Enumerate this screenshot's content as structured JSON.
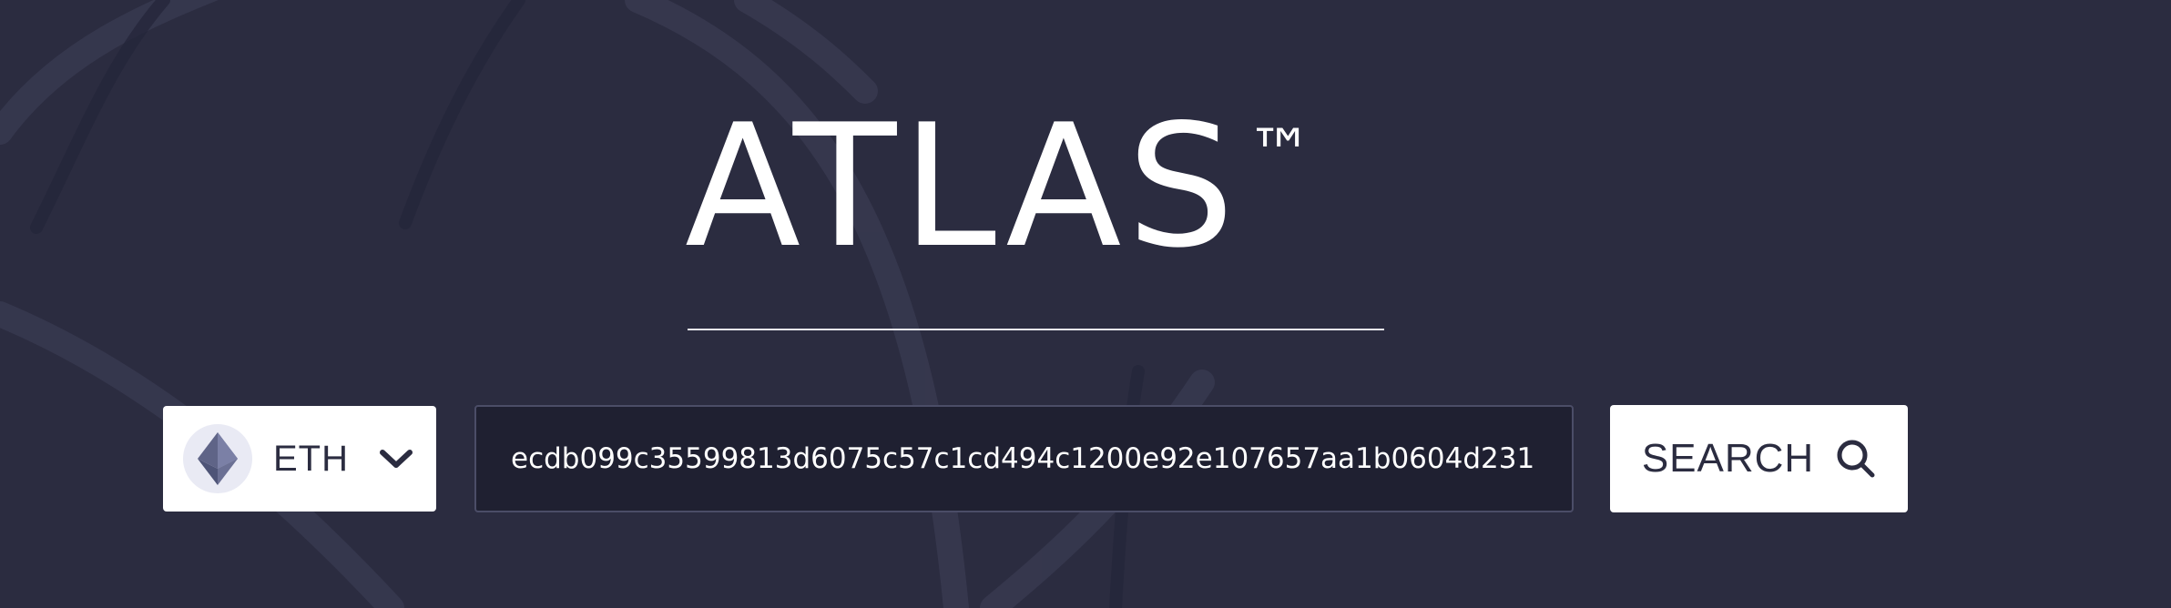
{
  "brand": {
    "name": "ATLAS",
    "trademark": "™"
  },
  "chain_selector": {
    "selected": "ETH",
    "icon": "ethereum-icon",
    "dropdown_icon": "chevron-down-icon"
  },
  "search": {
    "value": "ecdb099c35599813d6075c57c1cd494c1200e92e107657aa1b0604d231",
    "button_label": "SEARCH",
    "button_icon": "search-icon"
  },
  "colors": {
    "background": "#2b2c40",
    "input_background": "#1f2031",
    "input_border": "#4b4d67",
    "panel_text": "#2b2c40",
    "logo": "#ffffff"
  }
}
